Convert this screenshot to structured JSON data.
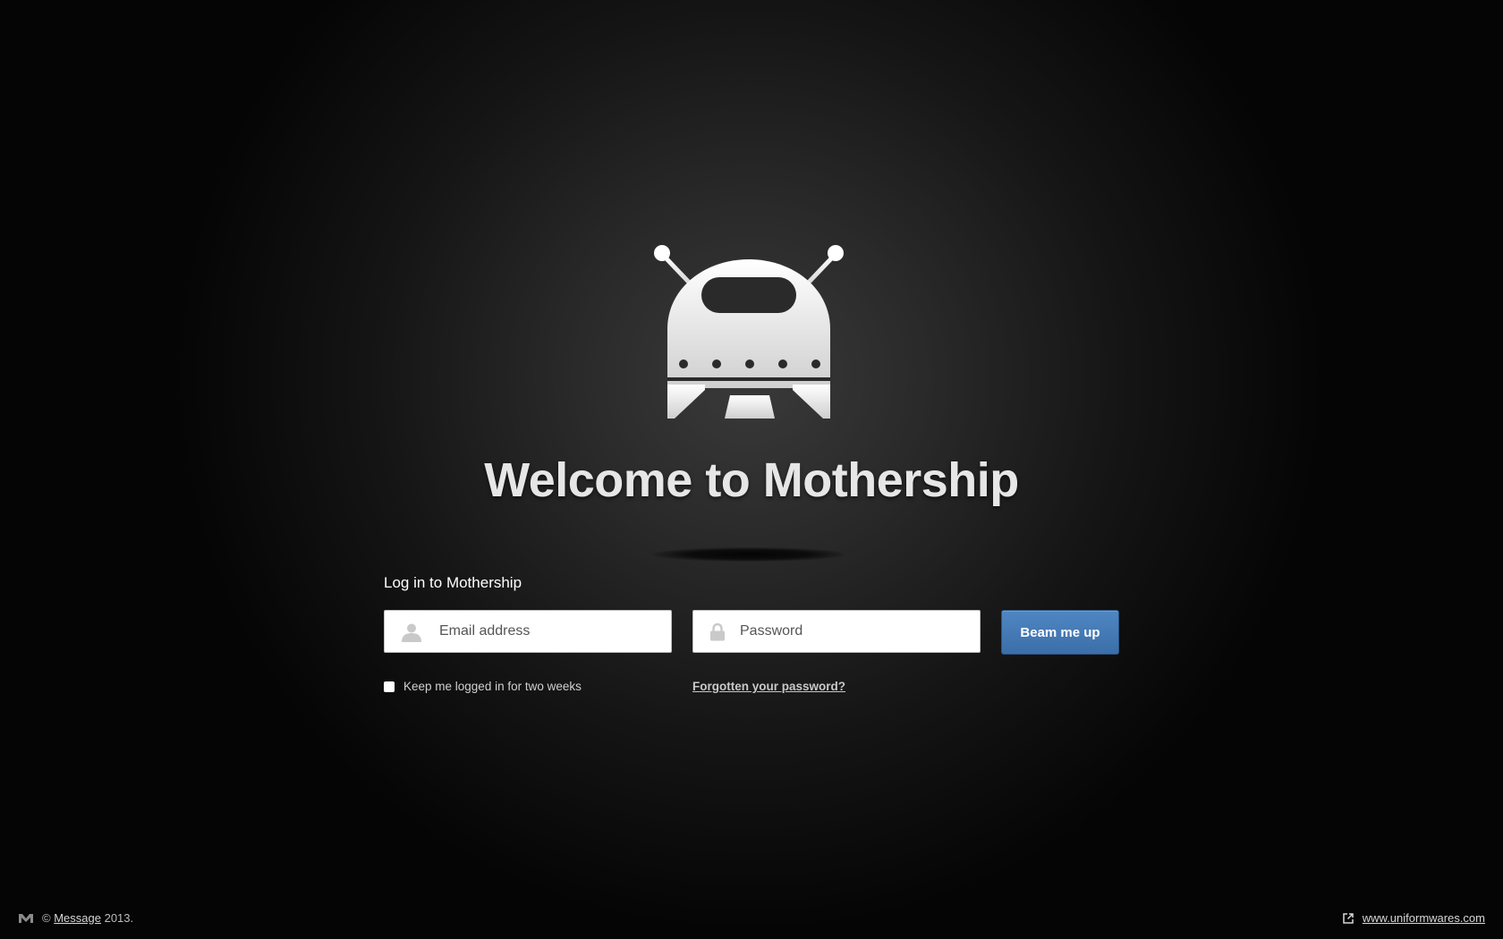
{
  "header": {
    "logo_icon": "robot-ship-icon",
    "title": "Welcome to Mothership"
  },
  "login": {
    "heading": "Log in to Mothership",
    "email_placeholder": "Email address",
    "email_value": "",
    "password_placeholder": "Password",
    "password_value": "",
    "submit_label": "Beam me up",
    "remember_label": "Keep me logged in for two weeks",
    "remember_checked": false,
    "forgot_label": "Forgotten your password?"
  },
  "footer": {
    "copyright_symbol": "©",
    "company_link": "Message",
    "year_text": "2013.",
    "website_link": "www.uniformwares.com"
  },
  "colors": {
    "accent_button": "#4a7fb9",
    "background": "#1a1a1a",
    "title": "#e6e6e6"
  }
}
